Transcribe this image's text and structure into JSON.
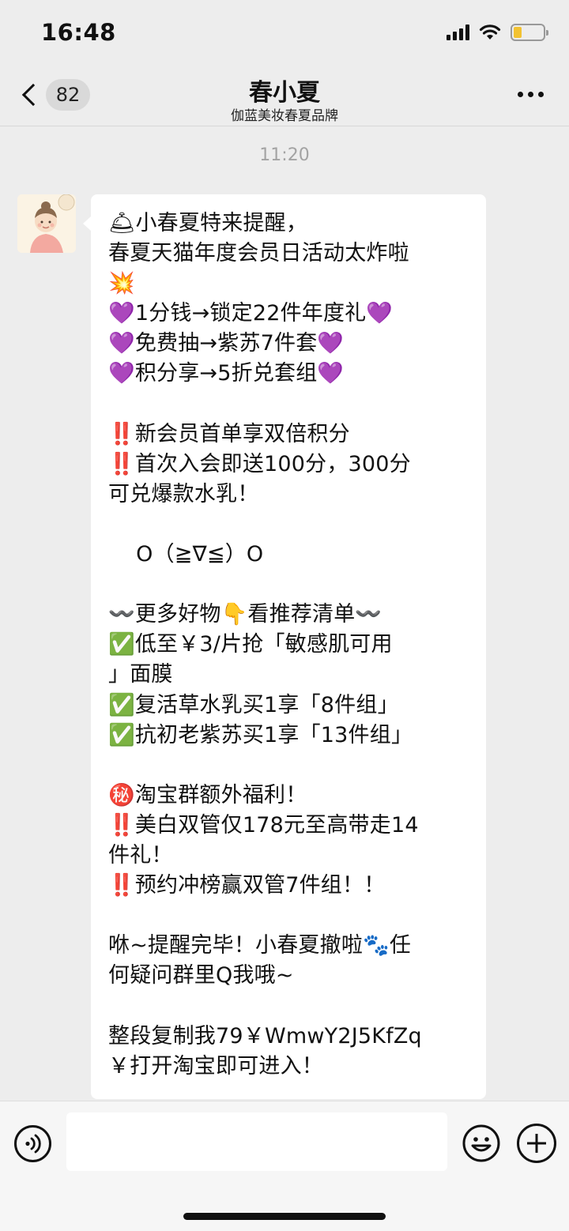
{
  "status_bar": {
    "time": "16:48",
    "icons": [
      "signal-icon",
      "wifi-icon",
      "battery-icon"
    ],
    "battery_level": 0.28,
    "battery_color": "#f2c232"
  },
  "nav": {
    "unread_count": "82",
    "title": "春小夏",
    "subtitle": "伽蓝美妆春夏品牌",
    "back_icon": "chevron-left-icon",
    "more_icon": "more-dots-icon"
  },
  "chat": {
    "timestamp": "11:20",
    "message_lines": [
      "🛎小春夏特来提醒，",
      "春夏天猫年度会员日活动太炸啦",
      "💥",
      "💜1分钱→锁定22件年度礼💜",
      "💜免费抽→紫苏7件套💜",
      "💜积分享→5折兑套组💜",
      "",
      "‼️新会员首单享双倍积分",
      "‼️首次入会即送100分，300分",
      "可兑爆款水乳！",
      "",
      "    O（≧∇≦）O",
      "",
      "〰️更多好物👇看推荐清单〰️",
      "✅低至￥3/片抢「敏感肌可用",
      "」面膜",
      "✅复活草水乳买1享「8件组」",
      "✅抗初老紫苏买1享「13件组」",
      "",
      "㊙️淘宝群额外福利！",
      "‼️美白双管仅178元至高带走14",
      "件礼！",
      "‼️预约冲榜赢双管7件组！！",
      "",
      "咻~提醒完毕！小春夏撤啦🐾任",
      "何疑问群里Q我哦~",
      "",
      "整段复制我79￥WmwY2J5KfZq",
      "￥打开淘宝即可进入！"
    ]
  },
  "input_bar": {
    "voice_icon": "voice-icon",
    "input_value": "",
    "emoji_icon": "emoji-icon",
    "plus_icon": "plus-icon"
  },
  "colors": {
    "background": "#ededed",
    "bubble": "#ffffff",
    "timestamp": "#a3a3a3"
  }
}
